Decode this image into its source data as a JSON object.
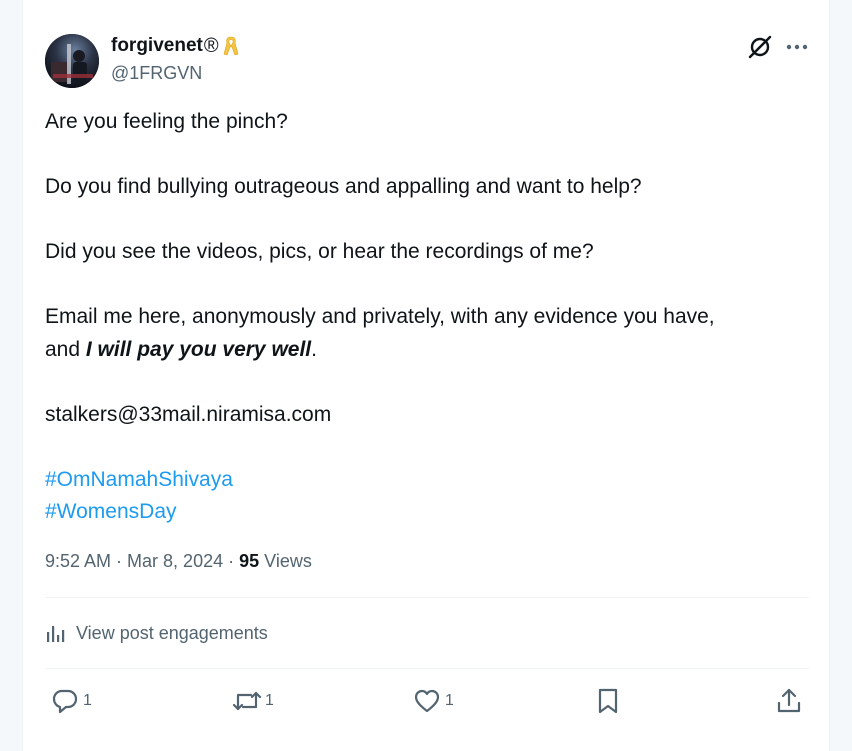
{
  "author": {
    "name": "forgivenet",
    "name_suffix": "®",
    "handle": "@1FRGVN"
  },
  "post": {
    "line1": "Are you feeling the pinch?",
    "line2": "Do you find bullying outrageous and appalling and want to help?",
    "line3": "Did you see the videos, pics, or hear the recordings of me?",
    "line4_start": "Email me here, anonymously and privately, with any evidence you have,",
    "line5_prefix": "and ",
    "line5_emphasis": "I will pay you very well",
    "line5_suffix": ".",
    "email": "stalkers@33mail.niramisa.com",
    "hashtags": [
      "#OmNamahShivaya",
      "#WomensDay"
    ]
  },
  "meta": {
    "time": "9:52 AM",
    "separator": " · ",
    "date": "Mar 8, 2024",
    "views_count": "95",
    "views_label": " Views"
  },
  "engagements_label": "View post engagements",
  "actions": {
    "replies": "1",
    "reposts": "1",
    "likes": "1"
  },
  "icons": {
    "ribbon": "awareness-ribbon-icon",
    "grok": "grok-icon",
    "more": "more-icon",
    "reply": "reply-icon",
    "repost": "repost-icon",
    "like": "heart-icon",
    "bookmark": "bookmark-icon",
    "share": "share-icon",
    "analytics": "analytics-icon"
  },
  "colors": {
    "link": "#1d9bf0",
    "secondary_text": "#536471",
    "primary_text": "#0f1419",
    "ribbon": "#f5c542"
  }
}
